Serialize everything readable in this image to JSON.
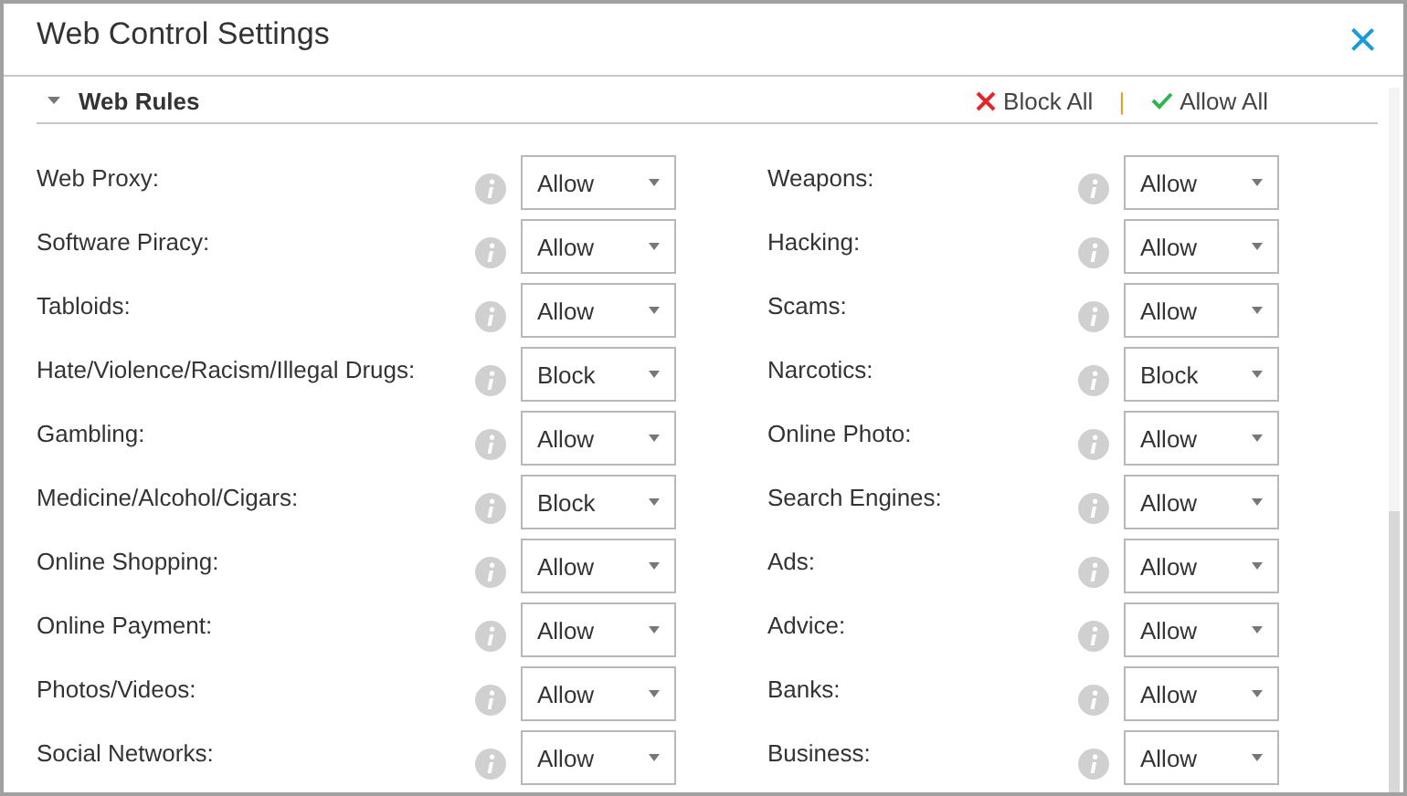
{
  "window": {
    "title": "Web Control Settings",
    "close": "×"
  },
  "section": {
    "title": "Web Rules",
    "expanded": true,
    "block_all": "Block All",
    "separator": "|",
    "allow_all": "Allow All"
  },
  "rules": [
    {
      "label": "Web Proxy:",
      "value": "Allow"
    },
    {
      "label": "Weapons:",
      "value": "Allow"
    },
    {
      "label": "Software Piracy:",
      "value": "Allow"
    },
    {
      "label": "Hacking:",
      "value": "Allow"
    },
    {
      "label": "Tabloids:",
      "value": "Allow"
    },
    {
      "label": "Scams:",
      "value": "Allow"
    },
    {
      "label": "Hate/Violence/Racism/Illegal Drugs:",
      "value": "Block"
    },
    {
      "label": "Narcotics:",
      "value": "Block"
    },
    {
      "label": "Gambling:",
      "value": "Allow"
    },
    {
      "label": "Online Photo:",
      "value": "Allow"
    },
    {
      "label": "Medicine/Alcohol/Cigars:",
      "value": "Block"
    },
    {
      "label": "Search Engines:",
      "value": "Allow"
    },
    {
      "label": "Online Shopping:",
      "value": "Allow"
    },
    {
      "label": "Ads:",
      "value": "Allow"
    },
    {
      "label": "Online Payment:",
      "value": "Allow"
    },
    {
      "label": "Advice:",
      "value": "Allow"
    },
    {
      "label": "Photos/Videos:",
      "value": "Allow"
    },
    {
      "label": "Banks:",
      "value": "Allow"
    },
    {
      "label": "Social Networks:",
      "value": "Allow"
    },
    {
      "label": "Business:",
      "value": "Allow"
    }
  ]
}
